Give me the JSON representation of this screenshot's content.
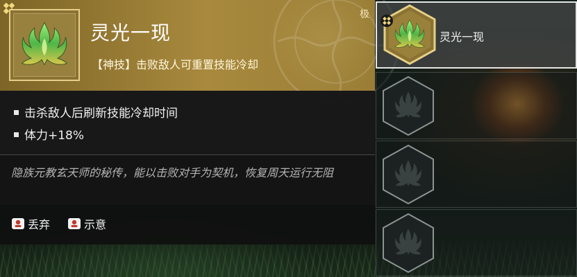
{
  "skill": {
    "name": "灵光一现",
    "rank_label": "极",
    "description": "【神技】击败敌人可重置技能冷却",
    "effects": [
      "击杀敌人后刷新技能冷却时间",
      "体力+18%"
    ],
    "lore": "隐族元教玄天师的秘传，能以击败对手为契机，恢复周天运行无阻"
  },
  "actions": [
    {
      "label": "丢弃",
      "icon": "gamepad-button-icon"
    },
    {
      "label": "示意",
      "icon": "gamepad-button-icon"
    }
  ],
  "slots": [
    {
      "label": "灵光一现",
      "state": "selected"
    },
    {
      "label": "",
      "state": "empty"
    },
    {
      "label": "",
      "state": "empty"
    },
    {
      "label": "",
      "state": "empty"
    }
  ],
  "colors": {
    "gold_header": "#a8893d",
    "gold_border": "#e6cf8a",
    "panel_dark": "#181818",
    "lore_text": "#b5b5b5",
    "flame_green": "#6fd05a",
    "flame_yellow": "#e8d25a"
  }
}
